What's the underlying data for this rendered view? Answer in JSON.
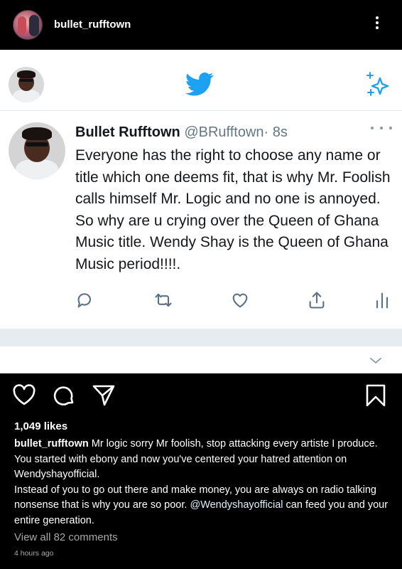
{
  "post": {
    "username": "bullet_rufftown"
  },
  "tweet": {
    "name": "Bullet Rufftown",
    "handle": "@BRufftown",
    "time": "· 8s",
    "text": "Everyone has the right to choose any name or title which one deems fit, that is why Mr. Foolish calls himself Mr. Logic and no one is annoyed. So why are u crying over the Queen of Ghana Music title. Wendy Shay is the Queen of Ghana Music period!!!!.",
    "icons": [
      "twitter-bird-icon",
      "sparkle-icon",
      "reply-icon",
      "retweet-icon",
      "like-icon",
      "share-icon",
      "analytics-icon",
      "chevron-down-icon"
    ],
    "brand_color": "#1DA1F2"
  },
  "actions": {
    "likes": "1,049 likes",
    "icons": [
      "heart-icon",
      "comment-icon",
      "send-icon",
      "bookmark-icon"
    ]
  },
  "caption": {
    "username": "bullet_rufftown",
    "text_1": " Mr logic sorry Mr foolish, stop attacking every artiste I produce. You started with ebony and now you've centered your hatred attention on Wendyshayofficial.",
    "text_2": "Instead of you to go out there and make money, you are always on radio talking nonsense that is why you are so poor. ",
    "mention": "@Wendyshayofficial",
    "text_3": " can feed you and your entire generation."
  },
  "comments": {
    "view_all": "View all 82 comments"
  },
  "timestamp": "4 hours ago"
}
